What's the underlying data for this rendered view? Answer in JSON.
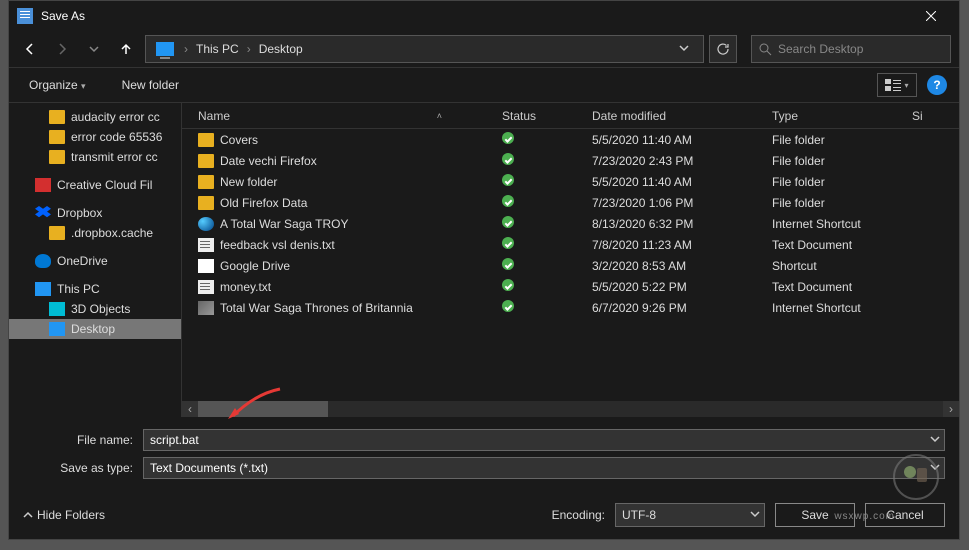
{
  "window": {
    "title": "Save As"
  },
  "breadcrumb": {
    "root": "This PC",
    "leaf": "Desktop"
  },
  "search": {
    "placeholder": "Search Desktop"
  },
  "toolbar": {
    "organize": "Organize",
    "new_folder": "New folder",
    "help": "?"
  },
  "columns": {
    "name": "Name",
    "status": "Status",
    "date": "Date modified",
    "type": "Type",
    "size": "Si"
  },
  "tree": {
    "audacity": "audacity error cc",
    "errcode": "error code 65536",
    "transmit": "transmit error cc",
    "cc": "Creative Cloud Fil",
    "dropbox": "Dropbox",
    "dbxcache": ".dropbox.cache",
    "onedrive": "OneDrive",
    "thispc": "This PC",
    "threed": "3D Objects",
    "desktop": "Desktop"
  },
  "rows": [
    {
      "icon": "folder",
      "name": "Covers",
      "date": "5/5/2020 11:40 AM",
      "type": "File folder"
    },
    {
      "icon": "folder",
      "name": "Date vechi Firefox",
      "date": "7/23/2020 2:43 PM",
      "type": "File folder"
    },
    {
      "icon": "folder",
      "name": "New folder",
      "date": "5/5/2020 11:40 AM",
      "type": "File folder"
    },
    {
      "icon": "folder",
      "name": "Old Firefox Data",
      "date": "7/23/2020 1:06 PM",
      "type": "File folder"
    },
    {
      "icon": "net",
      "name": "A Total War Saga TROY",
      "date": "8/13/2020 6:32 PM",
      "type": "Internet Shortcut"
    },
    {
      "icon": "txt",
      "name": "feedback vsl denis.txt",
      "date": "7/8/2020 11:23 AM",
      "type": "Text Document"
    },
    {
      "icon": "sc",
      "name": "Google Drive",
      "date": "3/2/2020 8:53 AM",
      "type": "Shortcut"
    },
    {
      "icon": "txt",
      "name": "money.txt",
      "date": "5/5/2020 5:22 PM",
      "type": "Text Document"
    },
    {
      "icon": "img",
      "name": "Total War Saga Thrones of Britannia",
      "date": "6/7/2020 9:26 PM",
      "type": "Internet Shortcut"
    }
  ],
  "form": {
    "filename_label": "File name:",
    "filename_value": "script.bat",
    "saveastype_label": "Save as type:",
    "saveastype_value": "Text Documents (*.txt)"
  },
  "footer": {
    "hide_folders": "Hide Folders",
    "encoding_label": "Encoding:",
    "encoding_value": "UTF-8",
    "save": "Save",
    "cancel": "Cancel"
  },
  "watermark": "wsxwp.com"
}
